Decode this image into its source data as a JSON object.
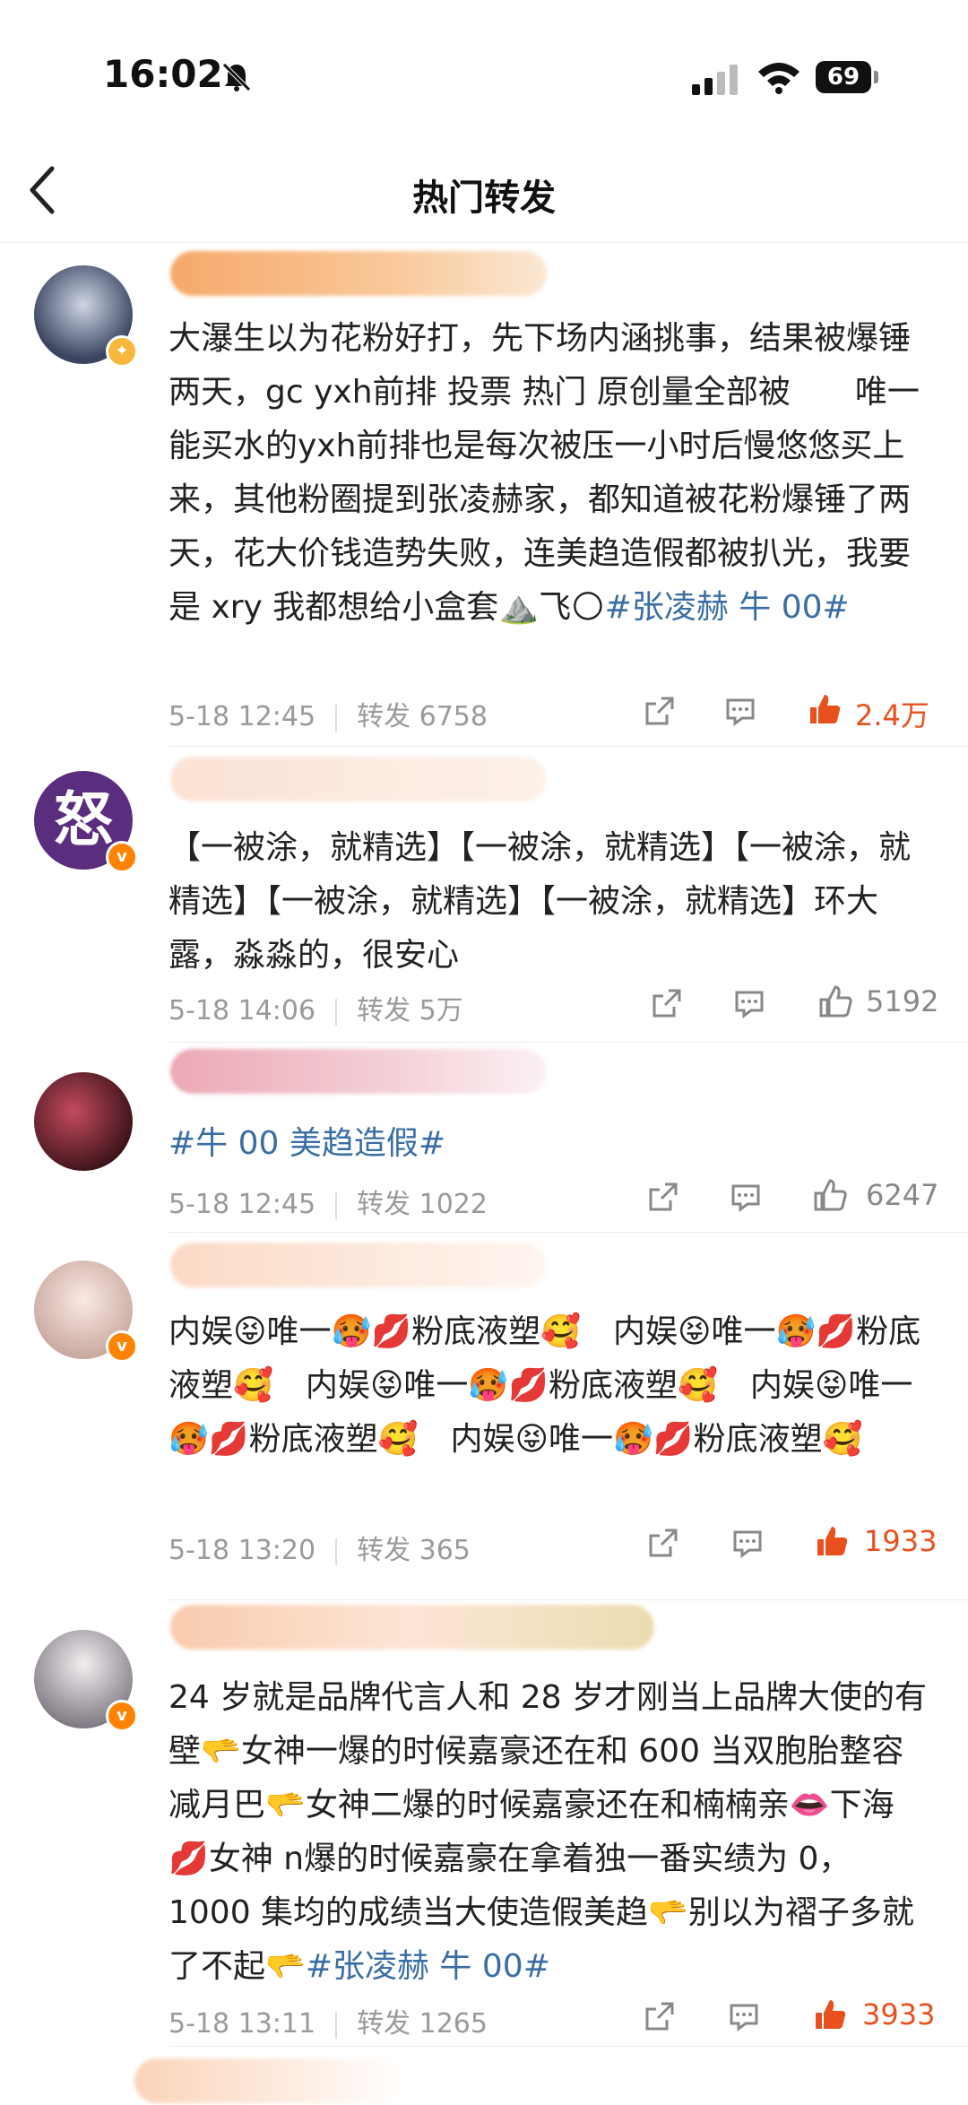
{
  "status_bar": {
    "time": "16:02",
    "battery": "69"
  },
  "nav": {
    "title": "热门转发"
  },
  "posts": [
    {
      "text": "大瀑生以为花粉好打，先下场内涵挑事，结果被爆锤两天，gc yxh前排 投票 热门 原创量全部被　　唯一能买水的yxh前排也是每次被压一小时后慢悠悠买上来，其他粉圈提到张凌赫家，都知道被花粉爆锤了两天，花大价钱造势失败，连美趋造假都被扒光，我要是 xry 我都想给小盒套⛰️飞🌕",
      "tag": "#张凌赫 牛 00#",
      "time": "5-18 12:45",
      "repost": "转发 6758",
      "likes": "2.4万",
      "liked": true
    },
    {
      "text": "【一被涂，就精选】【一被涂，就精选】【一被涂，就精选】【一被涂，就精选】【一被涂，就精选】环大露，淼淼的，很安心",
      "tag": "",
      "time": "5-18 14:06",
      "repost": "转发 5万",
      "likes": "5192",
      "liked": false
    },
    {
      "text": "",
      "tag": "#牛 00 美趋造假#",
      "time": "5-18 12:45",
      "repost": "转发 1022",
      "likes": "6247",
      "liked": false
    },
    {
      "text": "内娱😝唯一🥵💋粉底液塑🥰　内娱😝唯一🥵💋粉底液塑🥰　内娱😝唯一🥵💋粉底液塑🥰　内娱😝唯一🥵💋粉底液塑🥰　内娱😝唯一🥵💋粉底液塑🥰",
      "tag": "",
      "time": "5-18 13:20",
      "repost": "转发 365",
      "likes": "1933",
      "liked": true
    },
    {
      "text": "24 岁就是品牌代言人和 28 岁才刚当上品牌大使的有壁🫳女神一爆的时候嘉豪还在和 600 当双胞胎整容减月巴🫳女神二爆的时候嘉豪还在和楠楠亲👄下海💋女神 n爆的时候嘉豪在拿着独一番实绩为 0，1000 集均的成绩当大使造假美趋🫳别以为褶子多就了不起🫳",
      "tag": "#张凌赫 牛 00#",
      "time": "5-18 13:11",
      "repost": "转发 1265",
      "likes": "3933",
      "liked": true
    }
  ],
  "avatar_glyph": "怒"
}
